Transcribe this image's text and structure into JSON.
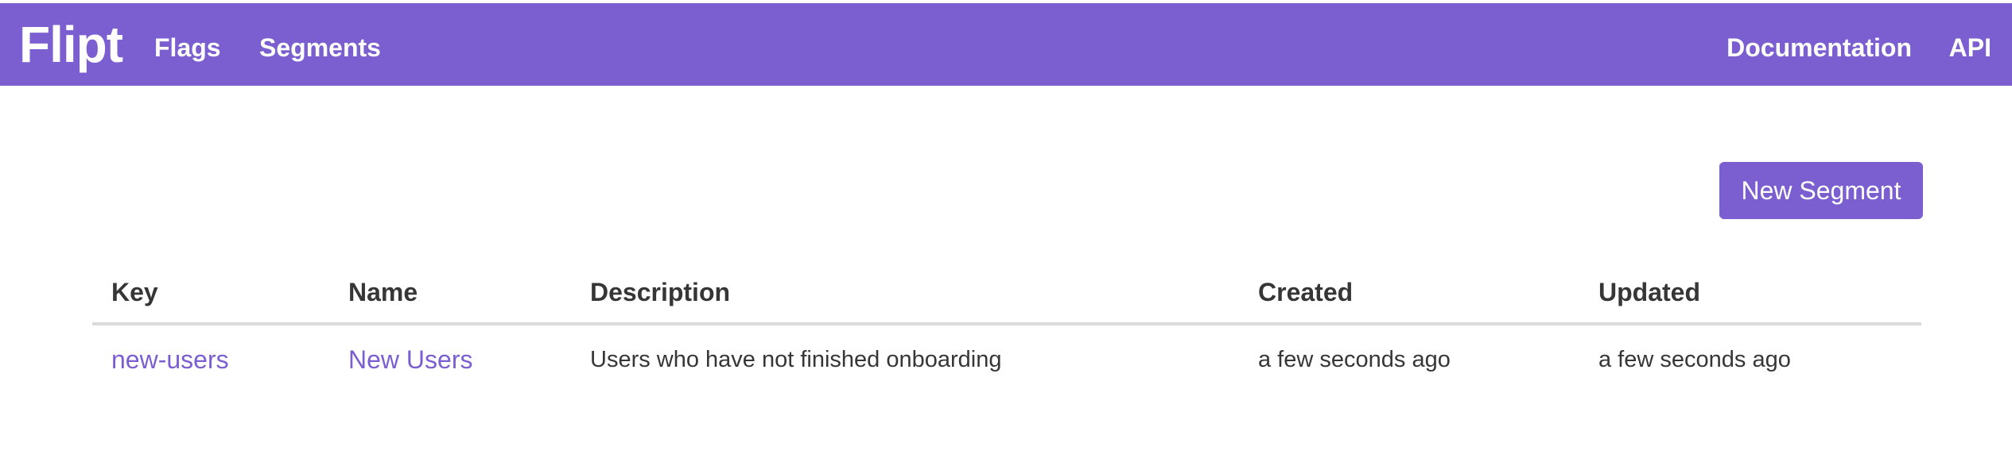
{
  "navbar": {
    "brand": "Flipt",
    "links_left": [
      "Flags",
      "Segments"
    ],
    "links_right": [
      "Documentation",
      "API"
    ],
    "color": "#7b5fd1"
  },
  "actions": {
    "new_segment_label": "New Segment"
  },
  "table": {
    "columns": [
      "Key",
      "Name",
      "Description",
      "Created",
      "Updated"
    ],
    "rows": [
      {
        "key": "new-users",
        "name": "New Users",
        "description": "Users who have not finished onboarding",
        "created": "a few seconds ago",
        "updated": "a few seconds ago"
      }
    ]
  }
}
